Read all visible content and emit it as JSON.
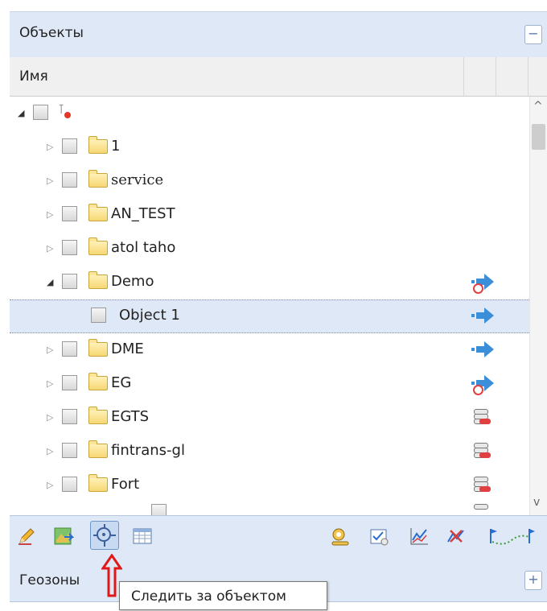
{
  "objects_panel": {
    "title": "Объекты",
    "collapse_symbol": "−"
  },
  "column": {
    "name_header": "Имя"
  },
  "tree": {
    "root": {
      "label": ""
    },
    "rows": [
      {
        "label": "1",
        "status_icon": ""
      },
      {
        "label": "service",
        "status_icon": ""
      },
      {
        "label": "AN_TEST",
        "status_icon": ""
      },
      {
        "label": "atol taho",
        "status_icon": ""
      },
      {
        "label": "Demo",
        "status_icon": "arrow-blocked-icon"
      },
      {
        "label": "Object 1",
        "status_icon": "arrow-icon"
      },
      {
        "label": "DME",
        "status_icon": "arrow-icon"
      },
      {
        "label": "EG",
        "status_icon": "arrow-blocked-icon"
      },
      {
        "label": "EGTS",
        "status_icon": "stack-icon"
      },
      {
        "label": "fintrans-gl",
        "status_icon": "stack-icon"
      },
      {
        "label": "Fort",
        "status_icon": "stack-icon"
      }
    ]
  },
  "geozones_panel": {
    "title": "Геозоны",
    "expand_symbol": "+"
  },
  "tooltip": {
    "text": "Следить за объектом"
  },
  "colors": {
    "panel_header_bg": "#dfe8f6",
    "selected_row_bg": "#dfe8f6",
    "arrow_blue": "#3b8fd8",
    "alert_red": "#e04040",
    "folder_yellow": "#f6d774"
  }
}
